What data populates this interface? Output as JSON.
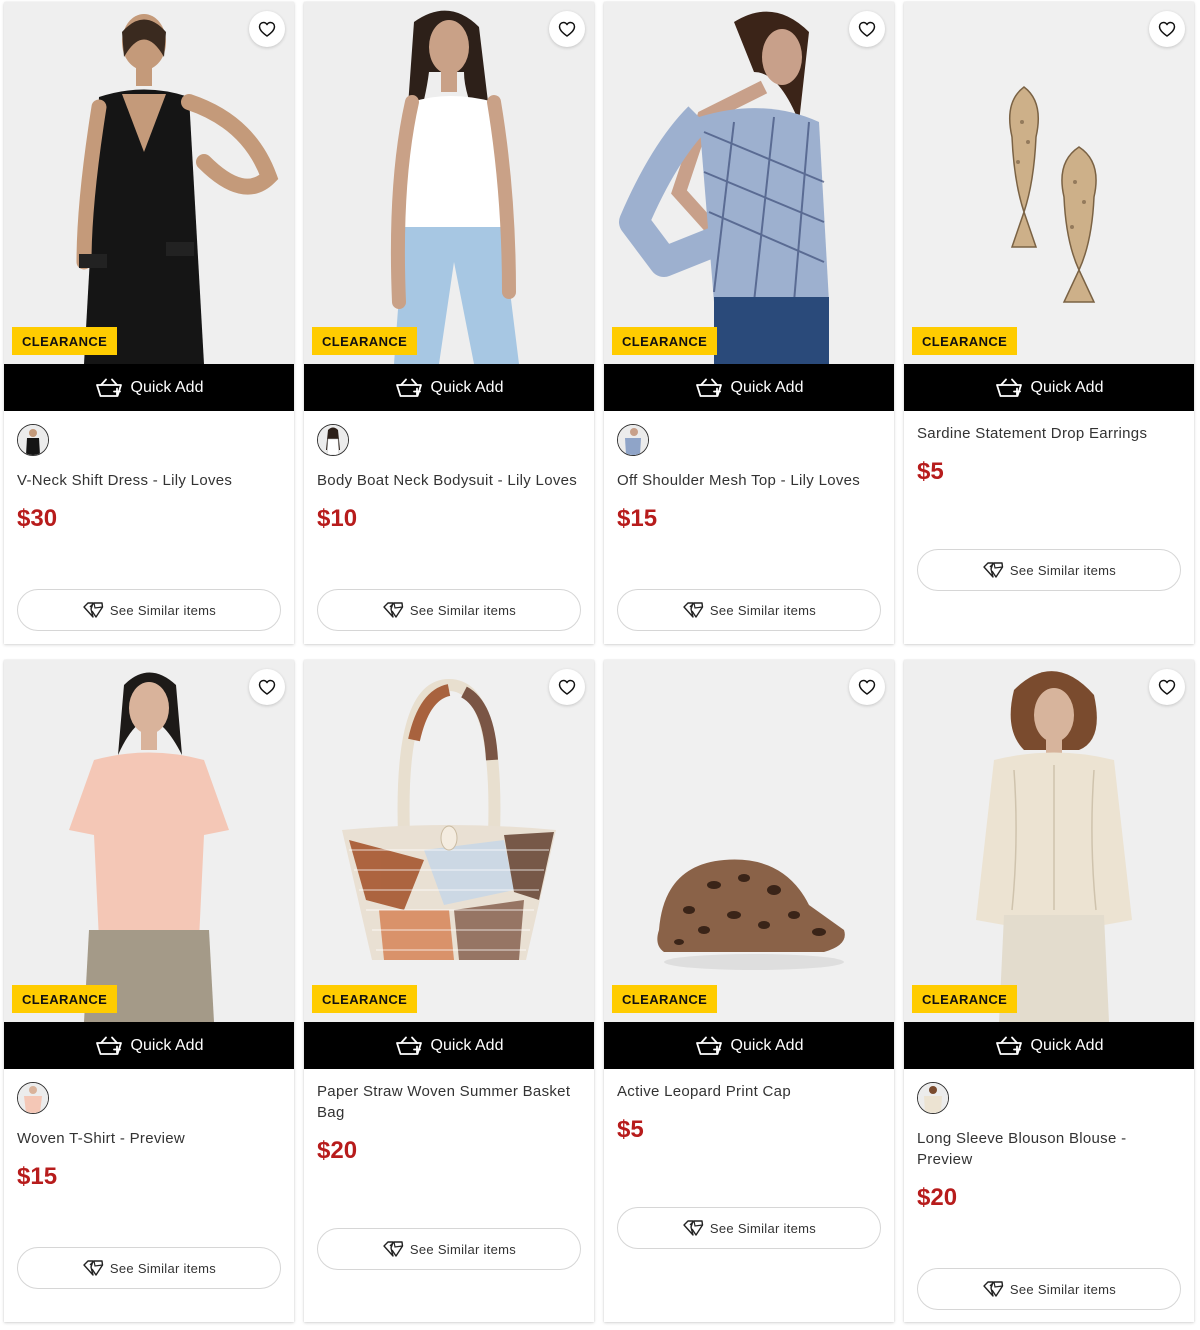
{
  "ui": {
    "quick_add_label": "Quick Add",
    "similar_label": "See Similar items",
    "badge_label": "CLEARANCE",
    "colors": {
      "price": "#b71c1c",
      "badge": "#ffcc00",
      "quick_add_bg": "#000000"
    }
  },
  "products": [
    {
      "name": "V-Neck Shift Dress - Lily Loves",
      "price": "$30",
      "badge": "CLEARANCE",
      "has_swatch": true,
      "image": "model-black-dress"
    },
    {
      "name": "Body Boat Neck Bodysuit - Lily Loves",
      "price": "$10",
      "badge": "CLEARANCE",
      "has_swatch": true,
      "image": "model-white-bodysuit"
    },
    {
      "name": "Off Shoulder Mesh Top - Lily Loves",
      "price": "$15",
      "badge": "CLEARANCE",
      "has_swatch": true,
      "image": "model-plaid-top"
    },
    {
      "name": "Sardine Statement Drop Earrings",
      "price": "$5",
      "badge": "CLEARANCE",
      "has_swatch": false,
      "image": "fish-earrings"
    },
    {
      "name": "Woven T-Shirt - Preview",
      "price": "$15",
      "badge": "CLEARANCE",
      "has_swatch": true,
      "image": "model-pink-tee"
    },
    {
      "name": "Paper Straw Woven Summer Basket Bag",
      "price": "$20",
      "badge": "CLEARANCE",
      "has_swatch": false,
      "image": "woven-basket-bag"
    },
    {
      "name": "Active Leopard Print Cap",
      "price": "$5",
      "badge": "CLEARANCE",
      "has_swatch": false,
      "image": "leopard-cap"
    },
    {
      "name": "Long Sleeve Blouson Blouse - Preview",
      "price": "$20",
      "badge": "CLEARANCE",
      "has_swatch": true,
      "image": "model-cream-blouse"
    }
  ]
}
